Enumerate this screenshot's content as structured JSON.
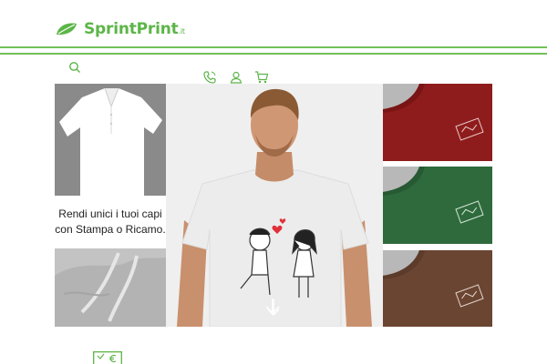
{
  "header": {
    "brand": {
      "name": "SprintPrint",
      "tld": ".it"
    },
    "icons": [
      "leaf-logo-icon",
      "search-icon",
      "phone-icon",
      "user-icon",
      "cart-icon"
    ]
  },
  "promo": {
    "line1": "Rendi unici i tuoi capi",
    "line2": "con Stampa o Ricamo."
  },
  "colors": {
    "brand_green": "#5cb548",
    "red_sweater": "#8f1c1c",
    "green_sweater": "#2f6a3c",
    "brown_sweater": "#6a4532"
  },
  "footer": {
    "icons": [
      "price-list-icon"
    ]
  }
}
